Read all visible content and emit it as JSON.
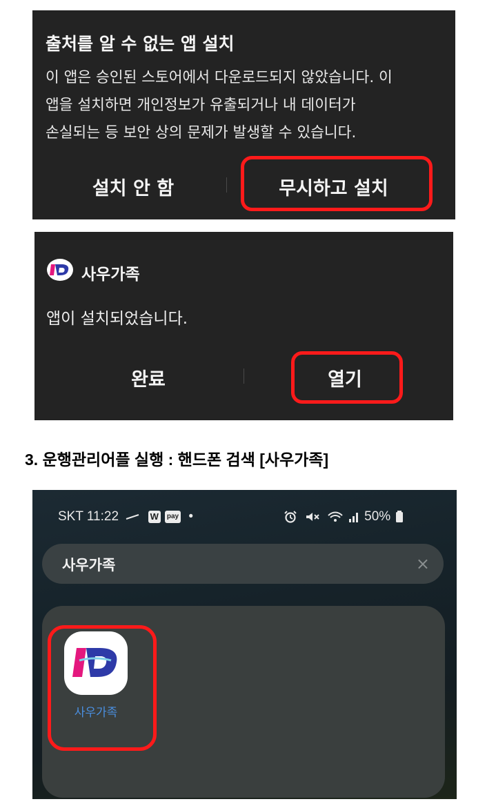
{
  "dialog1": {
    "title": "출처를 알 수 없는 앱 설치",
    "body_lines": [
      "이 앱은 승인된 스토어에서 다운로드되지 않았습니다. 이",
      "앱을 설치하면 개인정보가 유출되거나 내 데이터가",
      "손실되는 등 보안 상의 문제가 발생할 수 있습니다."
    ],
    "cancel_label": "설치 안 함",
    "install_label": "무시하고 설치"
  },
  "dialog2": {
    "app_name": "사우가족",
    "message": "앱이 설치되었습니다.",
    "done_label": "완료",
    "open_label": "열기"
  },
  "heading": "3. 운행관리어플 실행 : 핸드폰 검색 [사우가족]",
  "phone": {
    "status": {
      "carrier_time": "SKT 11:22",
      "badge_w": "W",
      "badge_pay": "pay",
      "dot": "•",
      "battery": "50%"
    },
    "search": {
      "query": "사우가족",
      "clear_icon": "×"
    },
    "result_app_label": "사우가족"
  },
  "colors": {
    "dialog_bg": "#232323",
    "highlight": "#ff1a1a",
    "app_label_blue": "#4a8fe0",
    "logo_blue": "#2e3aa8",
    "logo_magenta": "#e4187e"
  }
}
